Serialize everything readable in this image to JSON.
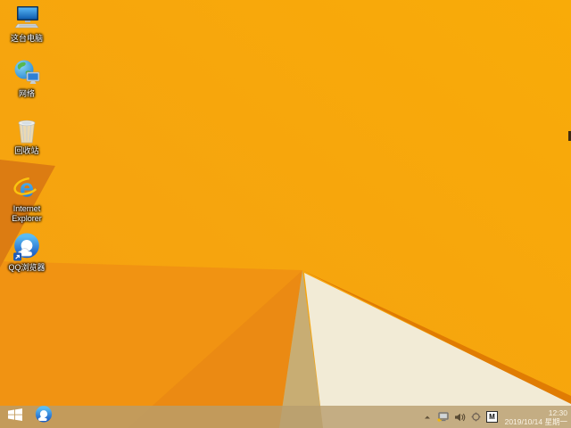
{
  "desktop": {
    "icons": [
      {
        "name": "this-pc",
        "icon": "computer-icon",
        "label": "这台电脑"
      },
      {
        "name": "network",
        "icon": "globe-monitor-icon",
        "label": "网络"
      },
      {
        "name": "recycle-bin",
        "icon": "trash-bin-icon",
        "label": "回收站"
      },
      {
        "name": "internet-explorer",
        "icon": "ie-e-icon",
        "label": "Internet Explorer"
      },
      {
        "name": "qq-browser",
        "icon": "qq-ring-cloud-icon",
        "label": "QQ浏览器"
      }
    ]
  },
  "taskbar": {
    "start_button": {
      "icon": "windows-flag-icon"
    },
    "pinned": [
      {
        "name": "qq-browser",
        "icon": "qq-ring-cloud-icon"
      }
    ],
    "tray": {
      "hidden_icons_arrow": "chevron-up-icon",
      "icons": [
        "network-warning-icon",
        "volume-icon",
        "compass-circle-icon"
      ],
      "ime_badge": "M",
      "time": "12:30",
      "date": "2019/10/14 星期一"
    }
  },
  "colors": {
    "wallpaper_orange": "#f7a50e",
    "wallpaper_wedge": "#dc7c12",
    "wallpaper_cream": "#f2ebd6",
    "wallpaper_khaki": "#c8ad73",
    "taskbar_tint": "#b89e6e",
    "warning_yellow": "#f2b70d"
  }
}
